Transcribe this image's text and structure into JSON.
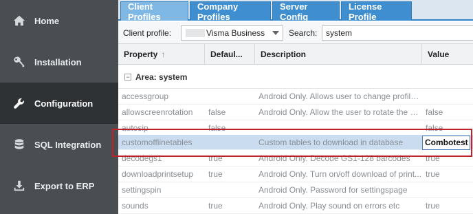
{
  "sidebar": {
    "items": [
      {
        "label": "Home",
        "icon": "home-icon"
      },
      {
        "label": "Installation",
        "icon": "key-icon"
      },
      {
        "label": "Configuration",
        "icon": "wrench-icon",
        "active": true
      },
      {
        "label": "SQL Integration",
        "icon": "database-icon"
      },
      {
        "label": "Export to ERP",
        "icon": "download-icon"
      }
    ]
  },
  "tabs": [
    {
      "label": "Client Profiles",
      "active": true
    },
    {
      "label": "Company Profiles"
    },
    {
      "label": "Server Config"
    },
    {
      "label": "License Profile"
    }
  ],
  "filters": {
    "client_profile_label": "Client profile:",
    "client_profile_value": "Visma Business",
    "search_label": "Search:",
    "search_value": "system"
  },
  "grid": {
    "columns": [
      "Property",
      "Defaul...",
      "Description",
      "Value"
    ],
    "sort_indicator": "↑",
    "group_label": "Area: system",
    "group_toggle": "−",
    "rows": [
      {
        "property": "accessgroup",
        "default": "",
        "description": "Android Only. Allows user to change profile ...",
        "value": ""
      },
      {
        "property": "allowscreenrotation",
        "default": "false",
        "description": "Android Only. Allow the user to rotate the app",
        "value": "false"
      },
      {
        "property": "autosip",
        "default": "false",
        "description": "",
        "value": "false"
      },
      {
        "property": "customofflinetables",
        "default": "",
        "description": "Custom tables to download in database",
        "value": "Combotest",
        "selected": true
      },
      {
        "property": "decodegs1",
        "default": "true",
        "description": "Android Only. Decode GS1-128 barcodes",
        "value": "true"
      },
      {
        "property": "downloadprintsetup",
        "default": "true",
        "description": "Android Only. Turn on/off download of print...",
        "value": "true"
      },
      {
        "property": "settingspin",
        "default": "",
        "description": "Android Only. Password for settingspage",
        "value": ""
      },
      {
        "property": "sounds",
        "default": "true",
        "description": "Android Only. Play sound on errors etc",
        "value": "true"
      }
    ]
  },
  "colors": {
    "sidebar_bg": "#4a4e52",
    "sidebar_active_bg": "#2f3235",
    "tab_bg": "#3f8fd0",
    "tab_active_bg": "#7fb7e5",
    "selected_row_bg": "#c9dcf0",
    "highlight_border": "#c0202a"
  }
}
